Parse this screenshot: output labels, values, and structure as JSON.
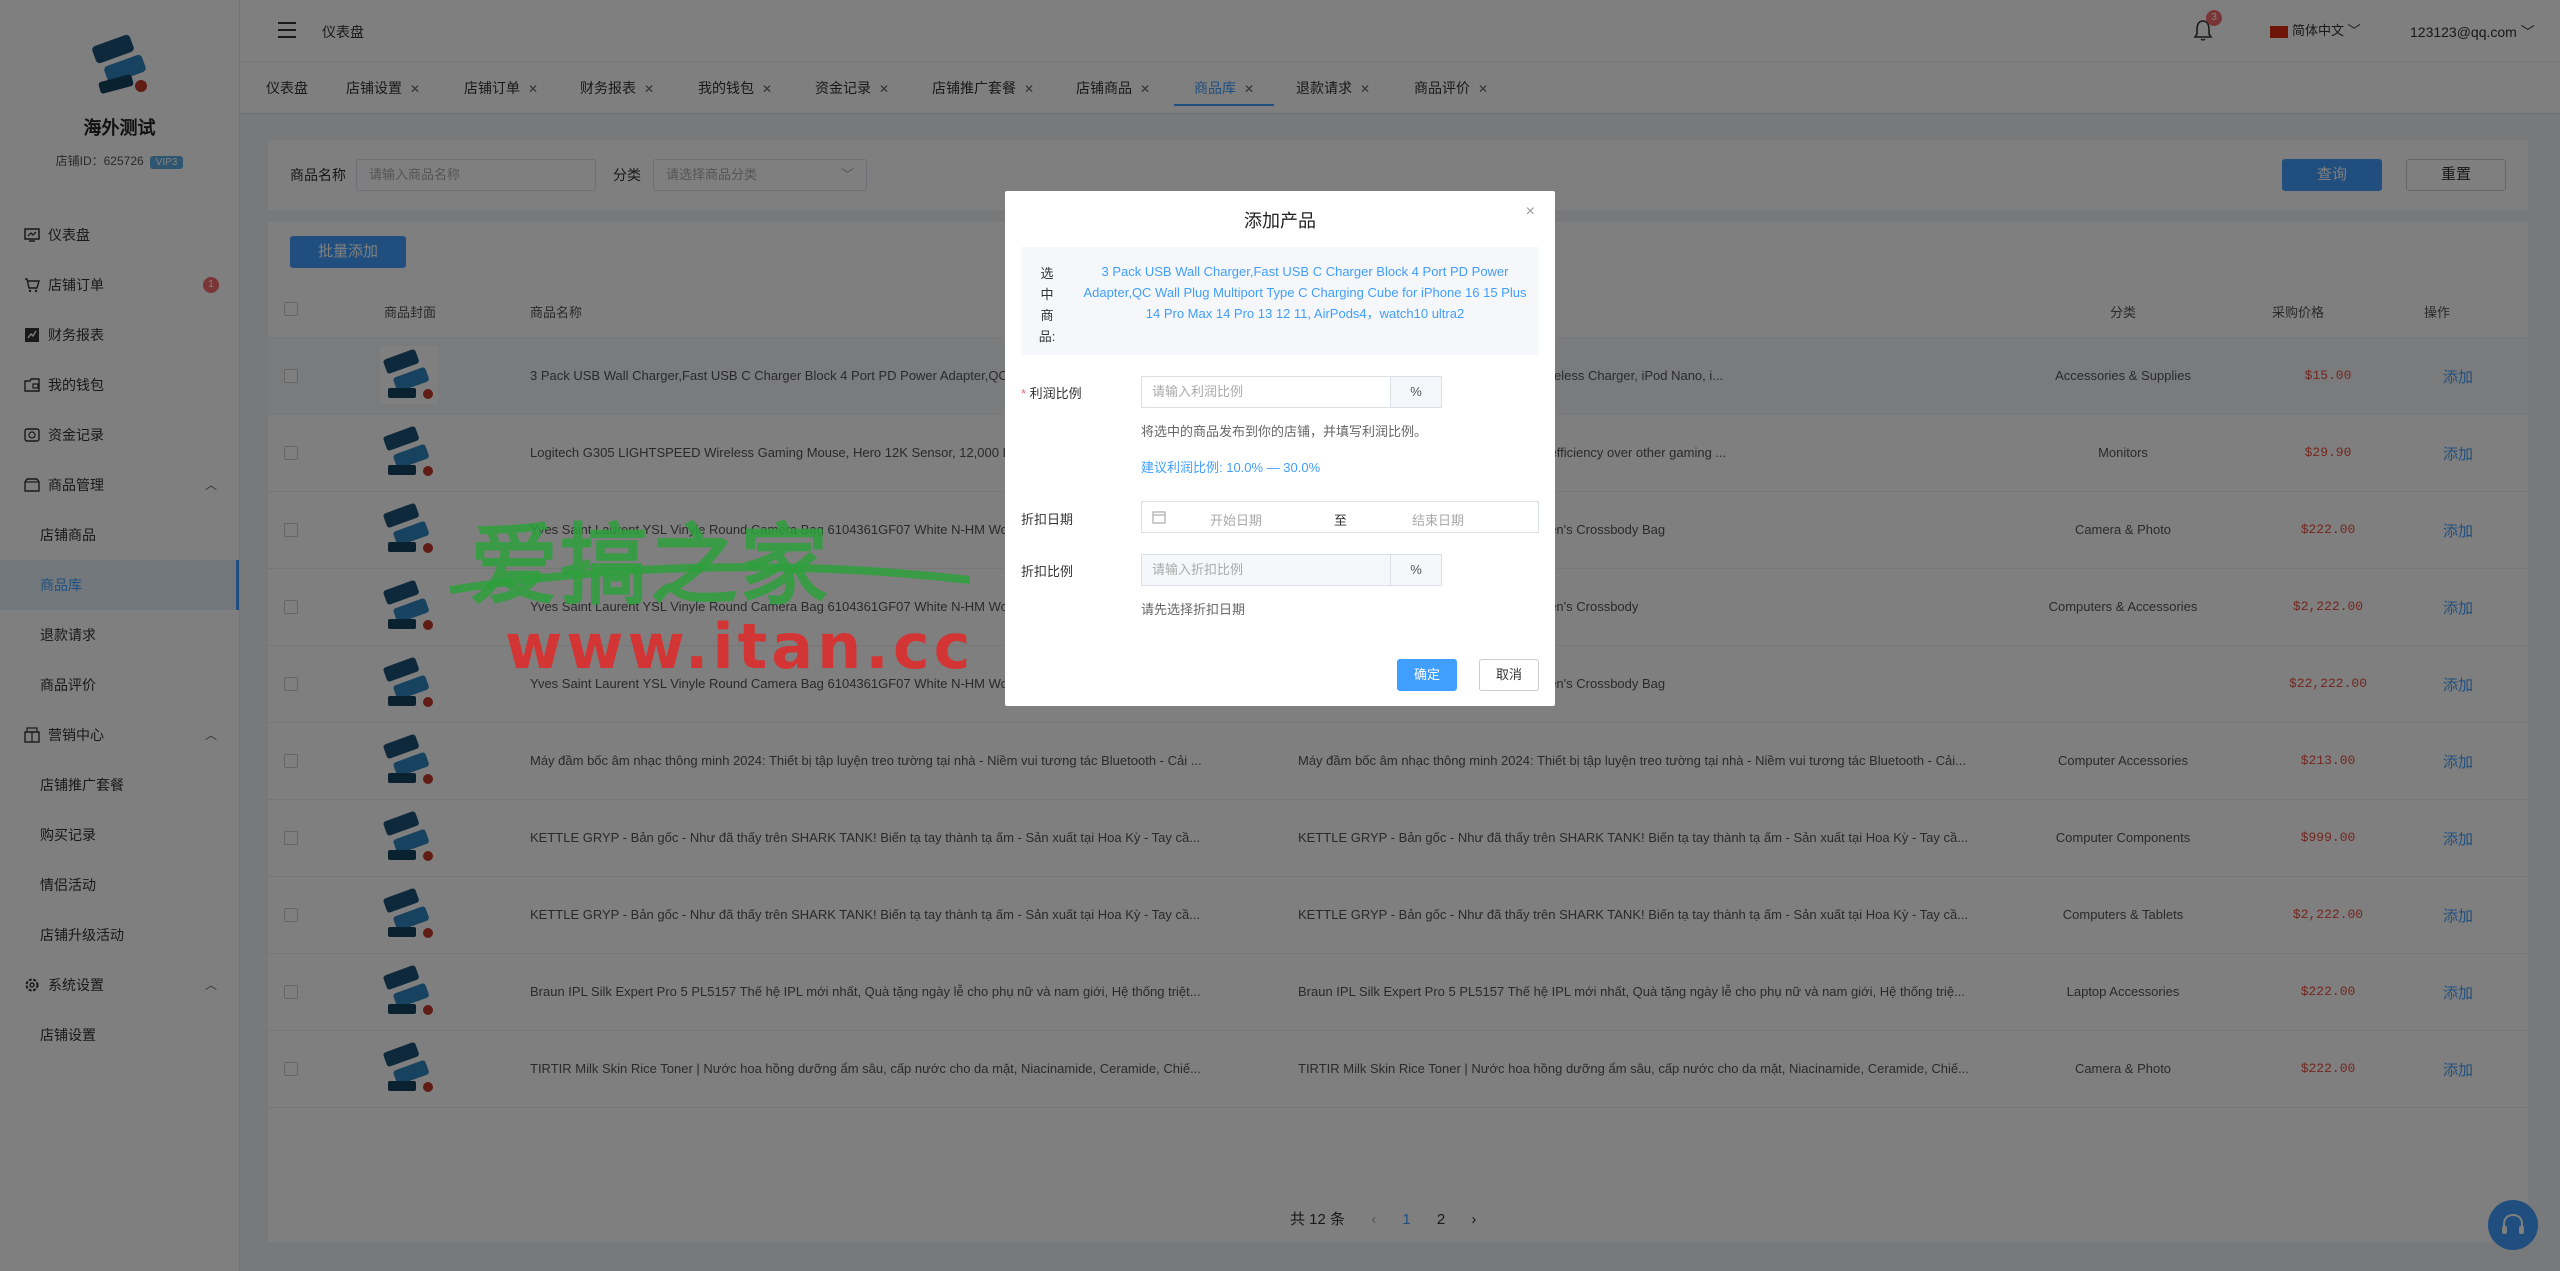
{
  "sidebar": {
    "shop_name": "海外测试",
    "shop_id_label": "店铺ID：625726",
    "vip": "VIP3",
    "items": [
      {
        "label": "仪表盘",
        "icon": "dashboard-icon"
      },
      {
        "label": "店铺订单",
        "icon": "cart-icon",
        "badge": "1"
      },
      {
        "label": "财务报表",
        "icon": "report-icon"
      },
      {
        "label": "我的钱包",
        "icon": "wallet-icon"
      },
      {
        "label": "资金记录",
        "icon": "funds-icon"
      },
      {
        "label": "商品管理",
        "icon": "goods-icon"
      },
      {
        "label": "店铺商品"
      },
      {
        "label": "商品库"
      },
      {
        "label": "退款请求"
      },
      {
        "label": "商品评价"
      },
      {
        "label": "营销中心",
        "icon": "marketing-icon"
      },
      {
        "label": "店铺推广套餐"
      },
      {
        "label": "购买记录"
      },
      {
        "label": "情侣活动"
      },
      {
        "label": "店铺升级活动"
      },
      {
        "label": "系统设置",
        "icon": "settings-icon"
      },
      {
        "label": "店铺设置"
      }
    ]
  },
  "header": {
    "breadcrumb": "仪表盘",
    "bell_count": "3",
    "language": "简体中文",
    "user": "123123@qq.com"
  },
  "tabs": [
    {
      "label": "仪表盘"
    },
    {
      "label": "店铺设置"
    },
    {
      "label": "店铺订单"
    },
    {
      "label": "财务报表"
    },
    {
      "label": "我的钱包"
    },
    {
      "label": "资金记录"
    },
    {
      "label": "店铺推广套餐"
    },
    {
      "label": "店铺商品"
    },
    {
      "label": "商品库"
    },
    {
      "label": "退款请求"
    },
    {
      "label": "商品评价"
    }
  ],
  "search": {
    "name_label": "商品名称",
    "name_placeholder": "请输入商品名称",
    "cat_label": "分类",
    "cat_placeholder": "请选择商品分类",
    "query": "查询",
    "reset": "重置"
  },
  "table": {
    "batch_add": "批量添加",
    "headers": {
      "cover": "商品封面",
      "name": "商品名称",
      "category": "分类",
      "price": "采购价格",
      "op": "操作"
    },
    "op_label": "添加",
    "rows": [
      {
        "name": "3 Pack USB Wall Charger,Fast USB C Charger Block 4 Port PD Power Adapter,QC Wall Plug Multiport Type C Charging Cube for iPhone 16 15 Plus",
        "desc": "Phones, iPad, iWatch, AirPods, Magsafe Wireless Charger, iPod Nano, i...",
        "category": "Accessories & Supplies",
        "price": "$15.00"
      },
      {
        "name": "Logitech G305 LIGHTSPEED Wireless Gaming Mouse, Hero 12K Sensor, 12,000 DPI, Lightweight, 6 Programmable Buttons",
        "desc": "mouse sensor delivers up to 10x the power efficiency over other gaming ...",
        "category": "Monitors",
        "price": "$29.90"
      },
      {
        "name": "Yves Saint Laurent YSL Vinyle Round Camera Bag 6104361GF07 White N-HM Women's Crossbody Bag",
        "desc": "mera Bag 6104361GF07 White N-HM Women's Crossbody Bag",
        "category": "Camera & Photo",
        "price": "$222.00"
      },
      {
        "name": "Yves Saint Laurent YSL Vinyle Round Camera Bag 6104361GF07 White N-HM Women's Crossbody",
        "desc": "mera Bag 6104361GF07 White N-HM Women's Crossbody",
        "category": "Computers & Accessories",
        "price": "$2,222.00"
      },
      {
        "name": "Yves Saint Laurent YSL Vinyle Round Camera Bag 6104361GF07 White N-HM Women's Crossbody Bag",
        "desc": "mera Bag 6104361GF07 White N-HM Women's Crossbody Bag",
        "category": "",
        "price": "$22,222.00"
      },
      {
        "name": "Máy đầm bốc âm nhạc thông minh 2024: Thiết bị tập luyện treo tường tại nhà - Niềm vui tương tác Bluetooth - Cải ...",
        "desc": "Máy đầm bốc âm nhạc thông minh 2024: Thiết bị tập luyện treo tường tại nhà - Niềm vui tương tác Bluetooth - Cải...",
        "category": "Computer Accessories",
        "price": "$213.00"
      },
      {
        "name": "KETTLE GRYP - Bản gốc - Như đã thấy trên SHARK TANK! Biến tạ tay thành tạ ấm - Sản xuất tại Hoa Kỳ - Tay cầ...",
        "desc": "KETTLE GRYP - Bản gốc - Như đã thấy trên SHARK TANK! Biến tạ tay thành tạ ấm - Sản xuất tại Hoa Kỳ - Tay cầ...",
        "category": "Computer Components",
        "price": "$999.00"
      },
      {
        "name": "KETTLE GRYP - Bản gốc - Như đã thấy trên SHARK TANK! Biến tạ tay thành tạ ấm - Sản xuất tại Hoa Kỳ - Tay cầ...",
        "desc": "KETTLE GRYP - Bản gốc - Như đã thấy trên SHARK TANK! Biến tạ tay thành tạ ấm - Sản xuất tại Hoa Kỳ - Tay cầ...",
        "category": "Computers & Tablets",
        "price": "$2,222.00"
      },
      {
        "name": "Braun IPL Silk Expert Pro 5 PL5157 Thế hệ IPL mới nhất, Quà tặng ngày lễ cho phụ nữ và nam giới, Hệ thống triệt...",
        "desc": "Braun IPL Silk Expert Pro 5 PL5157 Thế hệ IPL mới nhất, Quà tặng ngày lễ cho phụ nữ và nam giới, Hệ thống triệ...",
        "category": "Laptop Accessories",
        "price": "$222.00"
      },
      {
        "name": "TIRTIR Milk Skin Rice Toner | Nước hoa hồng dưỡng ẩm sâu, cấp nước cho da mặt, Niacinamide, Ceramide, Chiế...",
        "desc": "TIRTIR Milk Skin Rice Toner | Nước hoa hồng dưỡng ẩm sâu, cấp nước cho da mặt, Niacinamide, Ceramide, Chiế...",
        "category": "Camera & Photo",
        "price": "$222.00"
      }
    ]
  },
  "pager": {
    "total": "共 12 条",
    "prev": "‹",
    "p1": "1",
    "p2": "2",
    "next": "›"
  },
  "dialog": {
    "title": "添加产品",
    "close": "×",
    "selected_label": "选中商品:",
    "selected_text": "3 Pack USB Wall Charger,Fast USB C Charger Block 4 Port PD Power Adapter,QC Wall Plug Multiport Type C Charging Cube for iPhone 16 15 Plus 14 Pro Max 14 Pro 13 12 11, AirPods4，watch10 ultra2",
    "profit_label": "利润比例",
    "profit_placeholder": "请输入利润比例",
    "percent": "%",
    "profit_hint": "将选中的商品发布到你的店铺，并填写利润比例。",
    "profit_suggest": "建议利润比例:   10.0% — 30.0%",
    "date_label": "折扣日期",
    "start_date": "开始日期",
    "to": "至",
    "end_date": "结束日期",
    "discount_label": "折扣比例",
    "discount_placeholder": "请输入折扣比例",
    "discount_hint": "请先选择折扣日期",
    "confirm": "确定",
    "cancel": "取消"
  },
  "watermark": {
    "line1": "爱搞之家",
    "line2": "www.itan.cc"
  },
  "colors": {
    "primary": "#409eff",
    "danger": "#f56c6c",
    "price": "#e74c3c"
  }
}
